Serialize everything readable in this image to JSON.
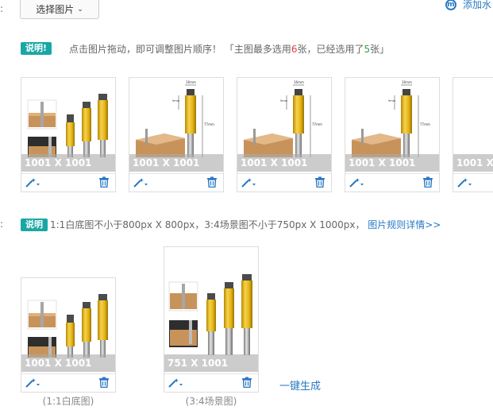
{
  "toolbar": {
    "select_image_label": "选择图片",
    "add_link_label": "添加水"
  },
  "main_images": {
    "badge": "说明!",
    "note_prefix": "点击图片拖动，即可调整图片顺序！ 「主图最多选用",
    "max_count": "6",
    "note_mid": "张，已经选用了",
    "used_count": "5",
    "note_suffix": "张」",
    "cards": [
      {
        "size_label": "1001 X 1001"
      },
      {
        "size_label": "1001 X 1001"
      },
      {
        "size_label": "1001 X 1001"
      },
      {
        "size_label": "1001 X 1001"
      },
      {
        "size_label": "1001 X 1"
      }
    ]
  },
  "scene_images": {
    "badge": "说明",
    "note": "1:1白底图不小于800px X 800px，3:4场景图不小于750px X 1000px，",
    "rules_link": "图片规则详情>>",
    "cards": [
      {
        "size_label": "1001 X 1001",
        "caption": "(1:1白底图)"
      },
      {
        "size_label": "751 X 1001",
        "caption": "(3:4场景图)"
      }
    ],
    "generate_link": "一键生成"
  },
  "colors": {
    "accent_teal": "#19a7a5",
    "link_blue": "#2a78c4",
    "tool_blue": "#2a78c4",
    "shank_gold": "#e2b41a"
  }
}
